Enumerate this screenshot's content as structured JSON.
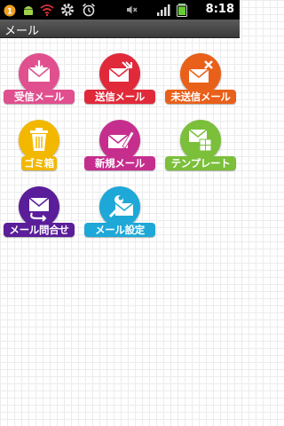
{
  "status_bar": {
    "time": "8:18",
    "icons": [
      "notification-icon",
      "android-icon",
      "wifi-icon",
      "settings-icon",
      "alarm-icon",
      "mute-icon",
      "signal-icon",
      "battery-icon"
    ]
  },
  "title_bar": {
    "title": "メール"
  },
  "tiles": [
    {
      "label": "受信メール",
      "icon": "inbox-mail-icon",
      "color": "#e0508f"
    },
    {
      "label": "送信メール",
      "icon": "sent-mail-icon",
      "color": "#e02a3a"
    },
    {
      "label": "未送信メール",
      "icon": "unsent-mail-icon",
      "color": "#e8601a"
    },
    {
      "label": "ゴミ箱",
      "icon": "trash-icon",
      "color": "#f2b800"
    },
    {
      "label": "新規メール",
      "icon": "new-mail-icon",
      "color": "#c62e8e"
    },
    {
      "label": "テンプレート",
      "icon": "template-icon",
      "color": "#7bbf3a"
    },
    {
      "label": "メール問合せ",
      "icon": "mail-inquiry-icon",
      "color": "#5a1e9a"
    },
    {
      "label": "メール設定",
      "icon": "mail-settings-icon",
      "color": "#1ea8d8"
    }
  ]
}
